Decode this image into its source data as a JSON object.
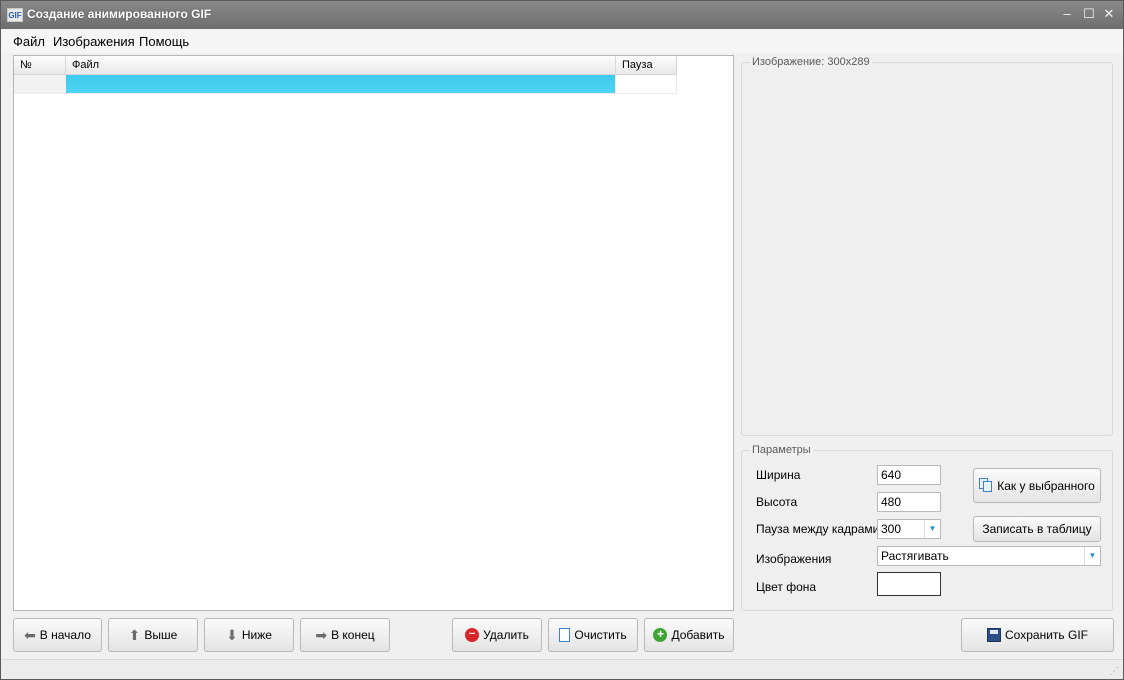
{
  "window": {
    "title": "Создание анимированного GIF",
    "icon_label": "GIF",
    "controls": {
      "minimize": "–",
      "maximize": "☐",
      "close": "✕"
    }
  },
  "menu": [
    "Файл",
    "Изображения",
    "Помощь"
  ],
  "grid": {
    "columns": [
      "№",
      "Файл",
      "Пауза"
    ],
    "rows": [
      {
        "num": "",
        "file": "",
        "pause": ""
      }
    ],
    "selected_color": "#3ccaee"
  },
  "preview": {
    "label": "Изображение: 300x289"
  },
  "params": {
    "label": "Параметры",
    "width_label": "Ширина",
    "width_value": "640",
    "height_label": "Высота",
    "height_value": "480",
    "pause_label": "Пауза между кадрами",
    "pause_value": "300",
    "images_label": "Изображения",
    "images_value": "Растягивать",
    "bg_label": "Цвет фона",
    "bg_color": "#ffffff",
    "same_as_selected": "Как у выбранного",
    "write_to_table": "Записать в таблицу"
  },
  "buttons": {
    "to_start": "В начало",
    "up": "Выше",
    "down": "Ниже",
    "to_end": "В конец",
    "delete": "Удалить",
    "clear": "Очистить",
    "add": "Добавить",
    "save": "Сохранить GIF"
  }
}
